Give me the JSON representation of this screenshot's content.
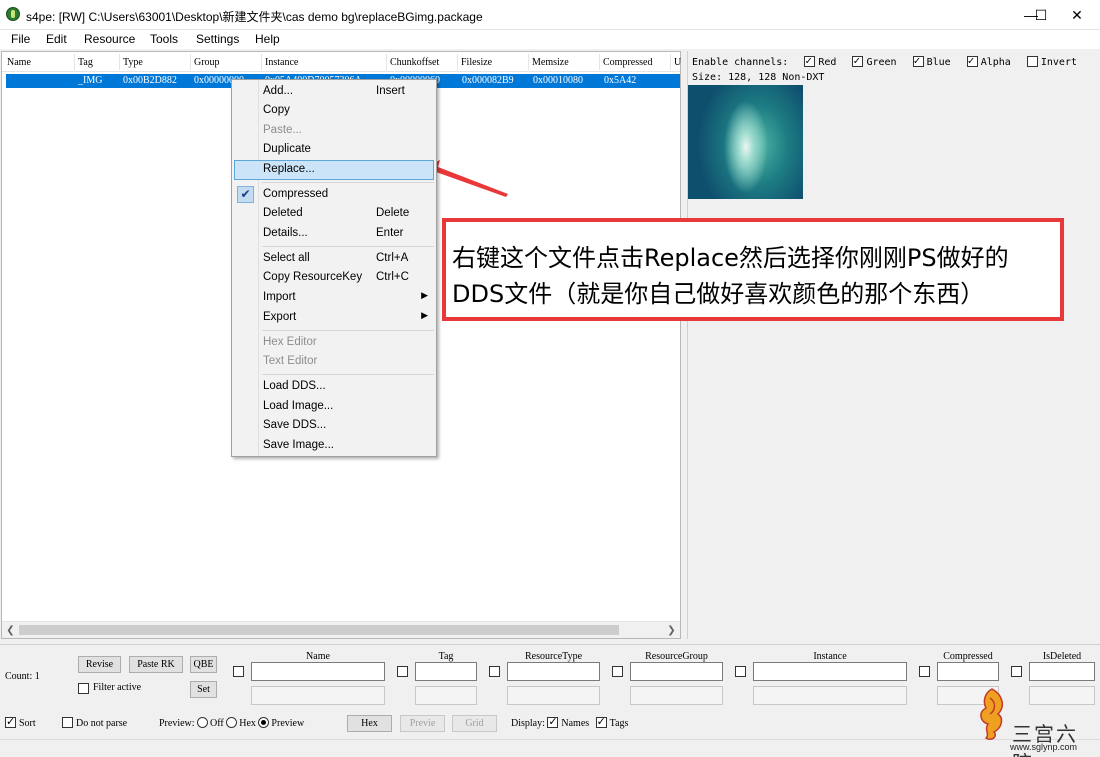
{
  "window": {
    "title": "s4pe: [RW] C:\\Users\\63001\\Desktop\\新建文件夹\\cas demo bg\\replaceBGimg.package",
    "minimize": "—",
    "maximize": "☐",
    "close": "✕"
  },
  "menu": {
    "items": [
      "File",
      "Edit",
      "Resource",
      "Tools",
      "Settings",
      "Help"
    ]
  },
  "list": {
    "columns": [
      "Name",
      "Tag",
      "Type",
      "Group",
      "Instance",
      "Chunkoffset",
      "Filesize",
      "Memsize",
      "Compressed",
      "U"
    ],
    "rows": [
      {
        "name": "",
        "tag": "_IMG",
        "type": "0x00B2D882",
        "group": "0x00000000",
        "instance": "0x05A400D70057306A",
        "chunkoffset": "0x00000060",
        "filesize": "0x000082B9",
        "memsize": "0x00010080",
        "compressed": "0x5A42"
      }
    ]
  },
  "context_menu": {
    "items": [
      {
        "label": "Add...",
        "shortcut": "Insert"
      },
      {
        "label": "Copy",
        "shortcut": ""
      },
      {
        "label": "Paste...",
        "shortcut": "",
        "disabled": true
      },
      {
        "label": "Duplicate",
        "shortcut": ""
      },
      {
        "label": "Replace...",
        "shortcut": "",
        "highlighted": true
      },
      {
        "label": "Compressed",
        "shortcut": "",
        "checked": true
      },
      {
        "label": "Deleted",
        "shortcut": "Delete"
      },
      {
        "label": "Details...",
        "shortcut": "Enter"
      },
      {
        "label": "Select all",
        "shortcut": "Ctrl+A"
      },
      {
        "label": "Copy ResourceKey",
        "shortcut": "Ctrl+C"
      },
      {
        "label": "Import",
        "submenu": true
      },
      {
        "label": "Export",
        "submenu": true
      },
      {
        "label": "Hex Editor",
        "disabled": true
      },
      {
        "label": "Text Editor",
        "disabled": true
      },
      {
        "label": "Load DDS..."
      },
      {
        "label": "Load Image..."
      },
      {
        "label": "Save DDS..."
      },
      {
        "label": "Save Image..."
      }
    ]
  },
  "preview": {
    "enable_channels_label": "Enable channels:",
    "channels": [
      {
        "label": "Red",
        "checked": true
      },
      {
        "label": "Green",
        "checked": true
      },
      {
        "label": "Blue",
        "checked": true
      },
      {
        "label": "Alpha",
        "checked": true
      },
      {
        "label": "Invert",
        "checked": false
      }
    ],
    "size_text": "Size:  128, 128  Non-DXT"
  },
  "annotation": {
    "line1": "右键这个文件点击Replace然后选择你刚刚PS做好的",
    "line2": "DDS文件（就是你自己做好喜欢颜色的那个东西）",
    "color": "#e8383a"
  },
  "bottom": {
    "count_label": "Count:  1",
    "revise": "Revise",
    "paste_rk": "Paste RK",
    "qbe": "QBE",
    "filter_active": "Filter active",
    "set": "Set",
    "filter_headers": [
      "Name",
      "Tag",
      "ResourceType",
      "ResourceGroup",
      "Instance",
      "Compressed",
      "IsDeleted"
    ],
    "sort": "Sort",
    "do_not_parse": "Do not parse",
    "preview_label": "Preview:",
    "preview_options": [
      "Off",
      "Hex",
      "Preview"
    ],
    "hex_button": "Hex",
    "previe_button": "Previe",
    "grid_button": "Grid",
    "display_label": "Display:",
    "names": "Names",
    "tags": "Tags"
  },
  "watermark": {
    "text": "三宫六院",
    "url": "www.sglynp.com"
  }
}
